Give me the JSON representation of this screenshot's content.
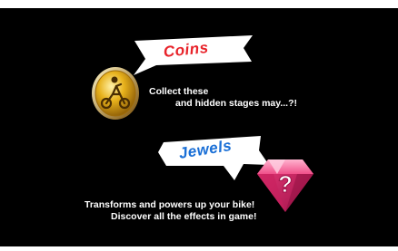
{
  "coins": {
    "title": "Coins",
    "title_color": "#e8232a",
    "desc_line1": "Collect these",
    "desc_line2": "and hidden stages may...?!",
    "icon": "coin-bike-icon"
  },
  "jewels": {
    "title": "Jewels",
    "title_color": "#1a6fd6",
    "desc_line1": "Transforms and powers up your bike!",
    "desc_line2": "Discover all the effects in game!",
    "icon": "pink-jewel-question-icon"
  },
  "colors": {
    "background": "#000000",
    "bubble": "#ffffff",
    "text": "#ffffff",
    "coin_gold": "#e8b21c",
    "jewel_pink": "#e83a78"
  }
}
